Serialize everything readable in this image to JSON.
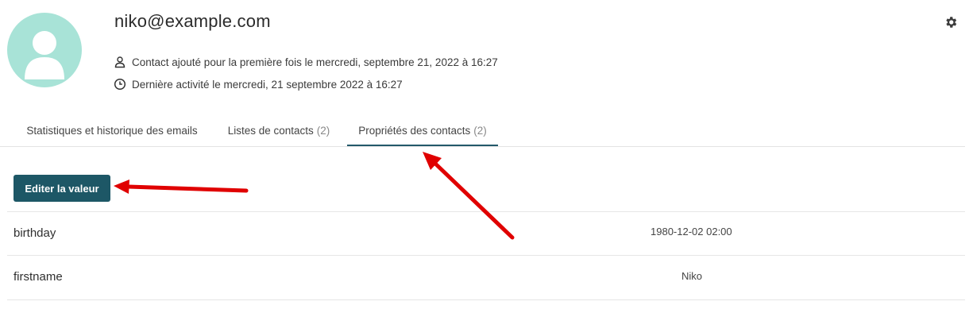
{
  "contact": {
    "email": "niko@example.com",
    "added_text": "Contact ajouté pour la première fois le mercredi, septembre 21, 2022 à 16:27",
    "activity_text": "Dernière activité le mercredi, 21 septembre 2022 à 16:27"
  },
  "tabs": [
    {
      "label": "Statistiques et historique des emails",
      "count": ""
    },
    {
      "label": "Listes de contacts",
      "count": "(2)"
    },
    {
      "label": "Propriétés des contacts",
      "count": "(2)",
      "active": true
    }
  ],
  "actions": {
    "edit_label": "Editer la valeur"
  },
  "properties": [
    {
      "key": "birthday",
      "value": "1980-12-02 02:00"
    },
    {
      "key": "firstname",
      "value": "Niko"
    }
  ],
  "icons": {
    "avatar": "user-avatar-icon",
    "added": "person-icon",
    "activity": "clock-icon",
    "settings": "gear-icon"
  },
  "colors": {
    "avatar_bg": "#a8e3d7",
    "primary": "#1d5766",
    "active_tab_underline": "#23596a",
    "annotation_arrow": "#e00000"
  }
}
